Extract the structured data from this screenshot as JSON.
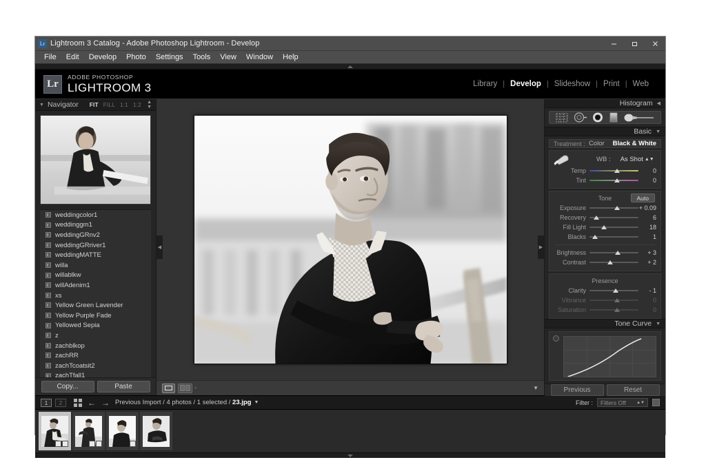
{
  "window": {
    "title": "Lightroom 3 Catalog - Adobe Photoshop Lightroom - Develop",
    "badge": "Lr",
    "controls": {
      "minimize": "minimize-icon",
      "restore": "restore-icon",
      "close": "close-icon"
    }
  },
  "menubar": {
    "items": [
      "File",
      "Edit",
      "Develop",
      "Photo",
      "Settings",
      "Tools",
      "View",
      "Window",
      "Help"
    ]
  },
  "header": {
    "logo_badge": "Lr",
    "logo_sub": "ADOBE PHOTOSHOP",
    "logo_main": "LIGHTROOM 3",
    "modules": [
      {
        "label": "Library",
        "active": false
      },
      {
        "label": "Develop",
        "active": true
      },
      {
        "label": "Slideshow",
        "active": false
      },
      {
        "label": "Print",
        "active": false
      },
      {
        "label": "Web",
        "active": false
      }
    ],
    "module_separator": "|"
  },
  "navigator": {
    "title": "Navigator",
    "zoom_levels": [
      {
        "label": "FIT",
        "active": true
      },
      {
        "label": "FILL",
        "active": false
      },
      {
        "label": "1:1",
        "active": false
      },
      {
        "label": "1:2",
        "active": false
      }
    ]
  },
  "presets": {
    "items": [
      "weddingcolor1",
      "weddinggm1",
      "weddingGRnv2",
      "weddingGRriver1",
      "weddingMATTE",
      "willa",
      "willablkw",
      "willAdenim1",
      "xs",
      "Yellow Green Lavender",
      "Yellow Purple Fade",
      "Yellowed Sepia",
      "z",
      "zachblkop",
      "zachRR",
      "zachTcoatsit2",
      "zachTfall1"
    ]
  },
  "left_buttons": {
    "copy": "Copy...",
    "paste": "Paste"
  },
  "right_buttons": {
    "previous": "Previous",
    "reset": "Reset"
  },
  "right_panel": {
    "histogram": {
      "title": "Histogram"
    },
    "tools": [
      "crop-overlay-icon",
      "spot-removal-icon",
      "red-eye-icon",
      "graduated-filter-icon",
      "adjustment-brush-icon"
    ],
    "basic": {
      "title": "Basic",
      "treatment_label": "Treatment :",
      "treatment_options": [
        {
          "label": "Color",
          "active": false
        },
        {
          "label": "Black & White",
          "active": true
        }
      ],
      "wb_label": "WB :",
      "wb_value": "As Shot",
      "wb_sliders": [
        {
          "label": "Temp",
          "value": "0",
          "pos": 50,
          "kind": "temp",
          "dim": false
        },
        {
          "label": "Tint",
          "value": "0",
          "pos": 50,
          "kind": "tint",
          "dim": false
        }
      ],
      "tone_title": "Tone",
      "auto_label": "Auto",
      "tone_sliders": [
        {
          "label": "Exposure",
          "value": "+ 0.09",
          "pos": 51,
          "dim": false
        },
        {
          "label": "Recovery",
          "value": "6",
          "pos": 9,
          "dim": false
        },
        {
          "label": "Fill Light",
          "value": "18",
          "pos": 24,
          "dim": false
        },
        {
          "label": "Blacks",
          "value": "1",
          "pos": 5,
          "dim": false
        },
        {
          "label": "Brightness",
          "value": "+ 3",
          "pos": 52,
          "dim": false
        },
        {
          "label": "Contrast",
          "value": "+ 2",
          "pos": 37,
          "dim": false
        }
      ],
      "presence_title": "Presence",
      "presence_sliders": [
        {
          "label": "Clarity",
          "value": "- 1",
          "pos": 48,
          "dim": false
        },
        {
          "label": "Vibrance",
          "value": "0",
          "pos": 50,
          "dim": true
        },
        {
          "label": "Saturation",
          "value": "0",
          "pos": 50,
          "dim": true
        }
      ]
    },
    "tone_curve": {
      "title": "Tone Curve"
    }
  },
  "center_toolbar": {
    "view_icon": "loupe-view-icon",
    "compare_icon": "before-after-icon",
    "dash": "-",
    "caret": "chevron-down-icon"
  },
  "filmstrip_bar": {
    "screen1": "1",
    "screen2": "2",
    "grid_icon": "grid-view-icon",
    "back_arrow": "back-arrow-icon",
    "forward_arrow": "forward-arrow-icon",
    "path_prefix": "Previous Import / 4 photos / 1 selected / ",
    "path_file": "23.jpg",
    "filter_label": "Filter :",
    "filter_value": "Filters Off"
  },
  "filmstrip": {
    "thumbs": [
      {
        "selected": true,
        "badges": 2
      },
      {
        "selected": false,
        "badges": 2
      },
      {
        "selected": false,
        "badges": 1
      },
      {
        "selected": false,
        "badges": 0
      }
    ]
  },
  "colors": {
    "panel_bg": "#252525",
    "canvas_bg": "#333333",
    "accent_text": "#ffffff",
    "chrome": "#4d4d4d"
  }
}
